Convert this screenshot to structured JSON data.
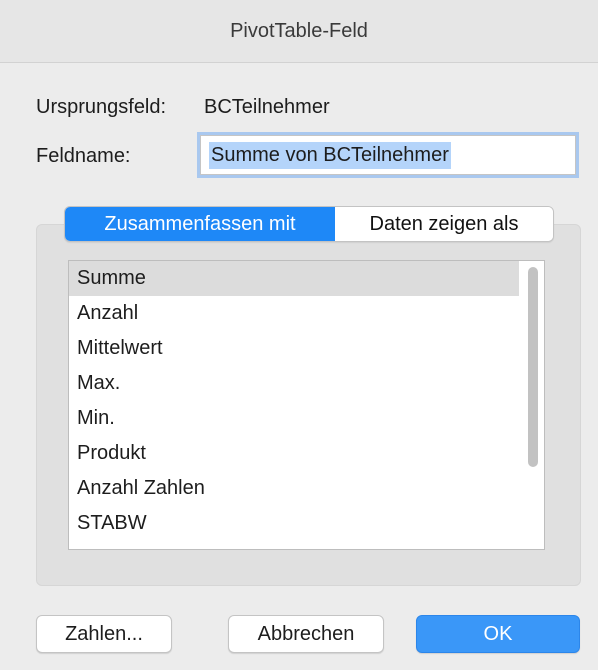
{
  "window": {
    "title": "PivotTable-Feld"
  },
  "source_field": {
    "label": "Ursprungsfeld:",
    "value": "BCTeilnehmer"
  },
  "field_name": {
    "label": "Feldname:",
    "value": "Summe von BCTeilnehmer"
  },
  "tabs": [
    {
      "label": "Zusammenfassen mit",
      "active": true
    },
    {
      "label": "Daten zeigen als",
      "active": false
    }
  ],
  "summary_list": {
    "selected": "Summe",
    "items": [
      "Summe",
      "Anzahl",
      "Mittelwert",
      "Max.",
      "Min.",
      "Produkt",
      "Anzahl Zahlen",
      "STABW"
    ]
  },
  "buttons": {
    "numbers": "Zahlen...",
    "cancel": "Abbrechen",
    "ok": "OK"
  },
  "colors": {
    "accent": "#1e88f7",
    "ok_button": "#3a97f8",
    "selection": "#b4d4fa"
  }
}
